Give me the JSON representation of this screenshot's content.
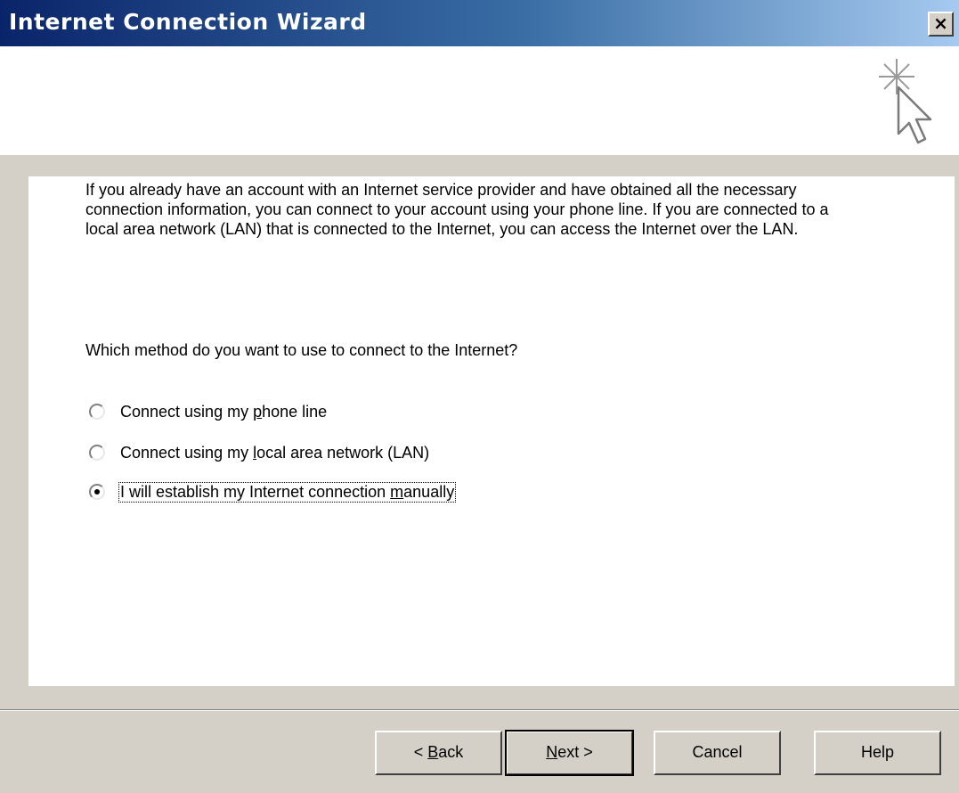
{
  "window": {
    "title": "Internet Connection Wizard",
    "close_label": "×"
  },
  "header": {
    "icon": "wizard-cursor-sparkle-icon"
  },
  "content": {
    "intro": "If you already have an account with an Internet service provider and have obtained all the necessary connection information, you can connect to your account using your phone line. If you are connected to a local area network (LAN) that is connected to the Internet, you can access the Internet over the LAN.",
    "question": "Which method do you want to use to connect to the Internet?",
    "options": [
      {
        "pre": "Connect using my ",
        "accel": "p",
        "post": "hone line",
        "selected": false
      },
      {
        "pre": "Connect using my ",
        "accel": "l",
        "post": "ocal area network (LAN)",
        "selected": false
      },
      {
        "pre": "I will establish my Internet connection ",
        "accel": "m",
        "post": "anually",
        "selected": true
      }
    ]
  },
  "buttons": {
    "back": {
      "pre": "< ",
      "accel": "B",
      "post": "ack"
    },
    "next": {
      "pre": "",
      "accel": "N",
      "post": "ext >"
    },
    "cancel": "Cancel",
    "help": "Help"
  }
}
